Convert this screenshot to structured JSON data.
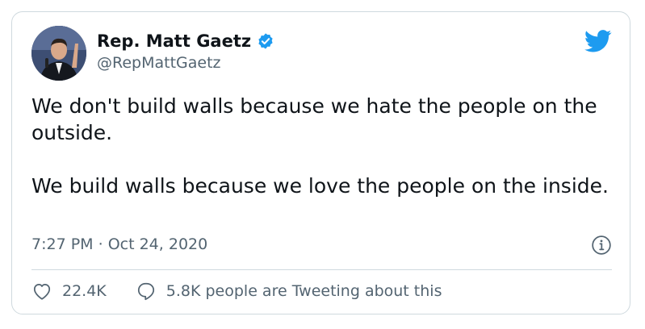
{
  "user": {
    "display_name": "Rep. Matt Gaetz",
    "handle": "@RepMattGaetz",
    "verified_icon": "verified-badge-icon",
    "avatar": "profile-photo"
  },
  "tweet": {
    "paragraph_1": "We don't build walls because we hate the people on the outside.",
    "paragraph_2": "We build walls because we love the people on the inside."
  },
  "meta": {
    "time": "7:27 PM",
    "separator": "·",
    "date": "Oct 24, 2020"
  },
  "actions": {
    "likes": "22.4K",
    "replies_text": "5.8K people are Tweeting about this"
  },
  "colors": {
    "accent": "#1d9bf0",
    "text": "#0f1419",
    "secondary": "#536471",
    "border": "#cfd9de"
  },
  "icons": [
    "twitter-bird-icon",
    "verified-badge-icon",
    "info-icon",
    "heart-icon",
    "reply-bubble-icon"
  ]
}
